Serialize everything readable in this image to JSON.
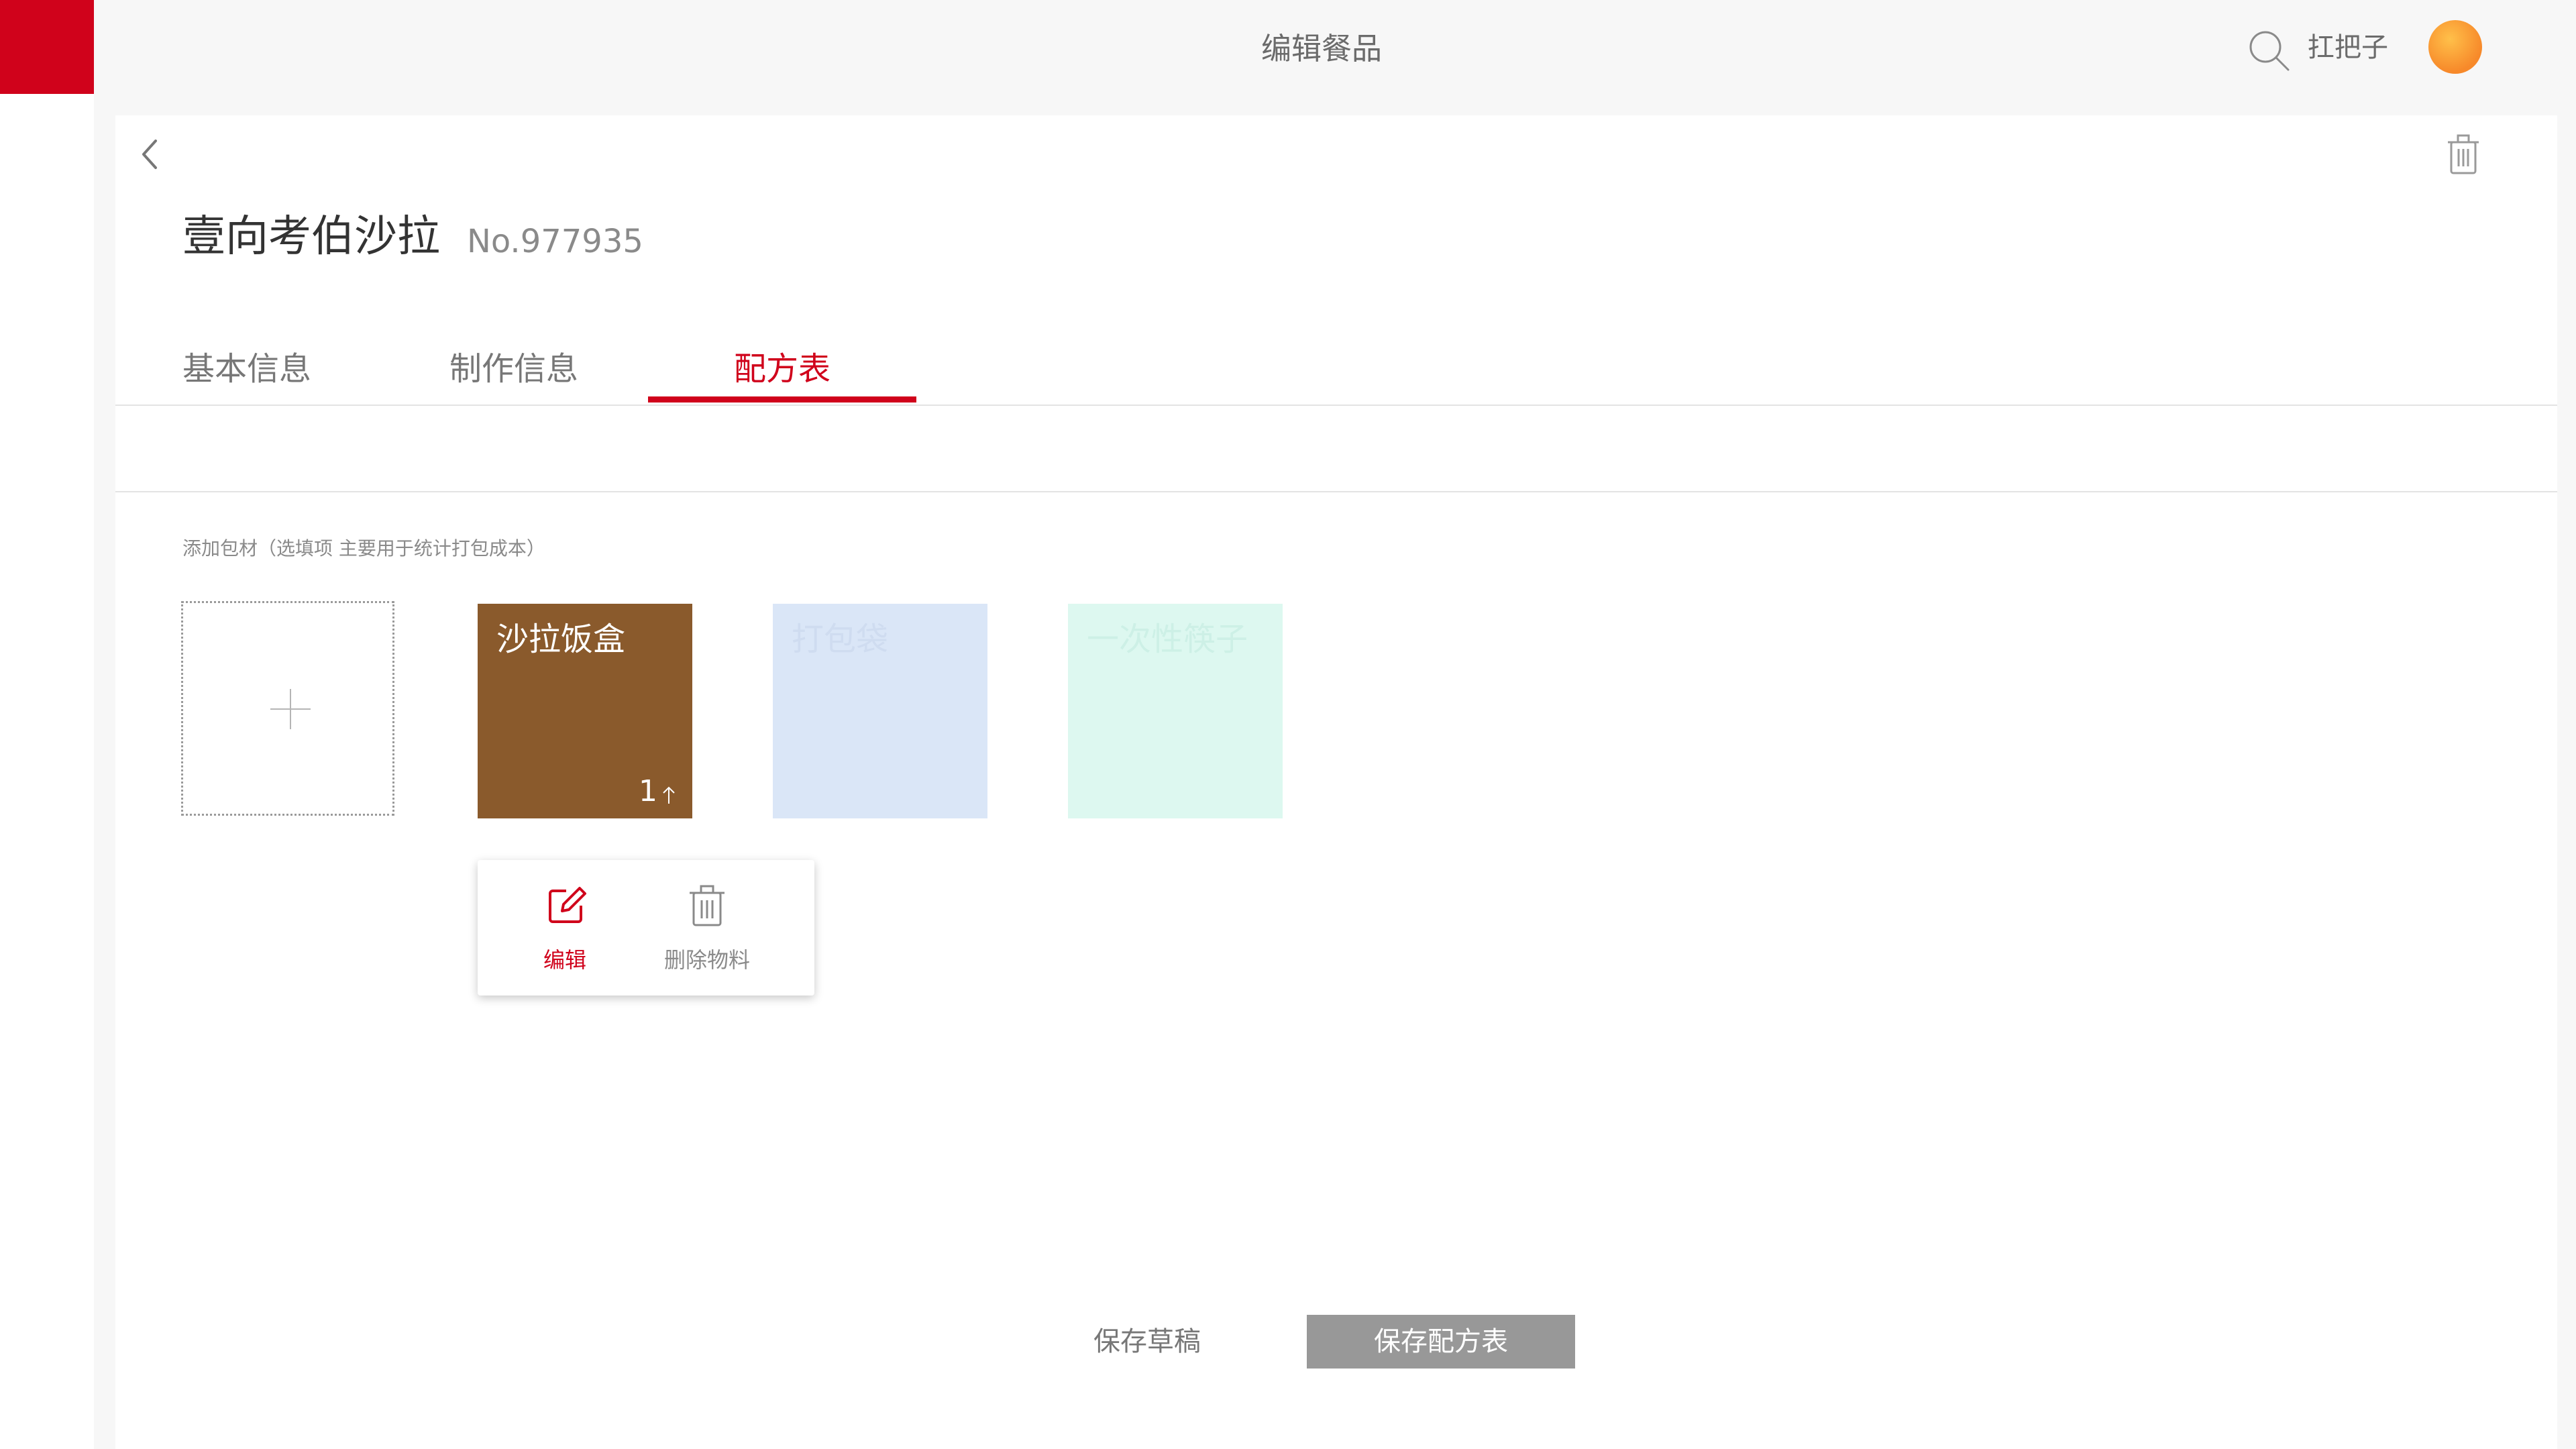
{
  "topbar": {
    "title": "编辑餐品",
    "user_name": "扛把子",
    "icons": {
      "search": "search-icon",
      "avatar": "avatar"
    }
  },
  "dish": {
    "name": "壹向考伯沙拉",
    "number": "No.977935"
  },
  "tabs": [
    {
      "label": "基本信息",
      "active": false
    },
    {
      "label": "制作信息",
      "active": false
    },
    {
      "label": "配方表",
      "active": true
    }
  ],
  "packaging": {
    "hint": "添加包材（选填项  主要用于统计打包成本）",
    "items": [
      {
        "label": "沙拉饭盒",
        "quantity": "1",
        "color": "#8a5a2c"
      },
      {
        "label": "打包袋",
        "color": "#dae6f7"
      },
      {
        "label": "一次性筷子",
        "color": "#ddf8f0"
      }
    ]
  },
  "popup": {
    "edit_label": "编辑",
    "delete_label": "删除物料"
  },
  "actions": {
    "save_draft": "保存草稿",
    "save_recipe": "保存配方表"
  },
  "colors": {
    "accent": "#d0021b",
    "primary_button": "#989898"
  }
}
